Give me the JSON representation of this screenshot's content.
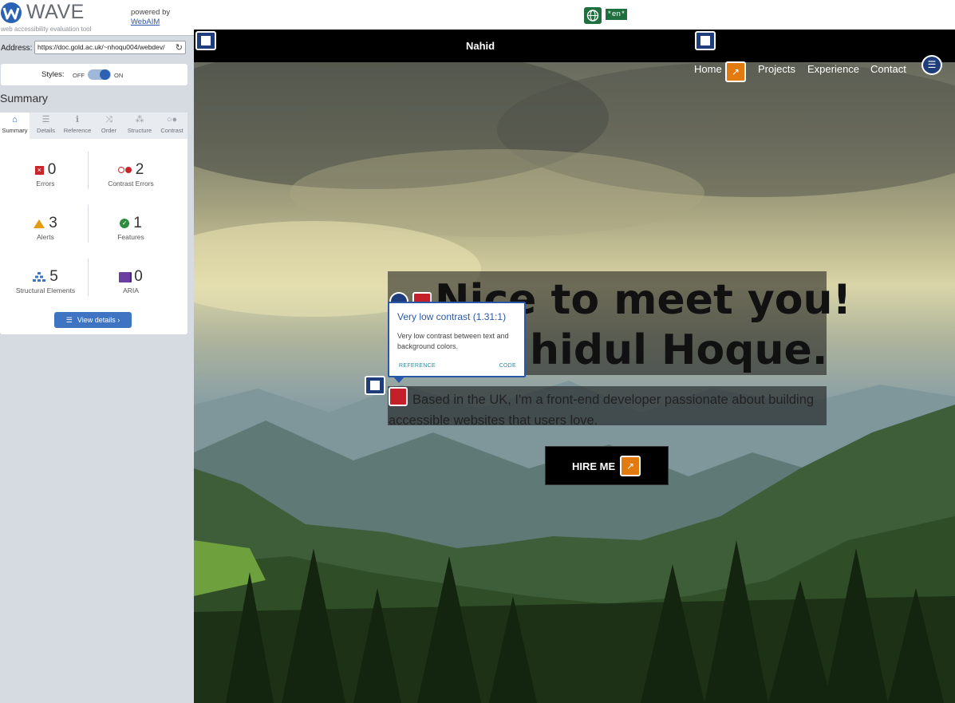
{
  "wave": {
    "logo_text": "WAVE",
    "tagline": "web accessibility evaluation tool",
    "powered_by": "powered by",
    "webaim": "WebAIM",
    "address_label": "Address:",
    "address_value": "https://doc.gold.ac.uk/~nhoqu004/webdev/",
    "styles_label": "Styles:",
    "styles_off": "OFF",
    "styles_on": "ON",
    "summary_title": "Summary",
    "tabs": [
      {
        "label": "Summary",
        "icon": "home-icon",
        "glyph": "⌂"
      },
      {
        "label": "Details",
        "icon": "list-icon",
        "glyph": "☰"
      },
      {
        "label": "Reference",
        "icon": "info-icon",
        "glyph": "ℹ"
      },
      {
        "label": "Order",
        "icon": "order-icon",
        "glyph": "⤨"
      },
      {
        "label": "Structure",
        "icon": "structure-icon",
        "glyph": "⁂"
      },
      {
        "label": "Contrast",
        "icon": "contrast-icon",
        "glyph": "○●"
      }
    ],
    "stats": {
      "errors": {
        "count": "0",
        "label": "Errors"
      },
      "contrast_errors": {
        "count": "2",
        "label": "Contrast Errors"
      },
      "alerts": {
        "count": "3",
        "label": "Alerts"
      },
      "features": {
        "count": "1",
        "label": "Features"
      },
      "structural": {
        "count": "5",
        "label": "Structural Elements"
      },
      "aria": {
        "count": "0",
        "label": "ARIA"
      }
    },
    "view_details": "View details ›"
  },
  "page": {
    "lang_badge": "*en*",
    "brand": "Nahid",
    "nav": [
      "Home",
      "Projects",
      "Experience",
      "Contact"
    ],
    "heading_line1": "Nice to meet you!",
    "heading_line2": "hidul Hoque.",
    "description": "Based in the UK, I'm a front-end developer passionate about building accessible websites that users love.",
    "hire_button": "HIRE ME"
  },
  "tooltip": {
    "title": "Very low contrast (1.31:1)",
    "body": "Very low contrast between text and background colors.",
    "reference": "REFERENCE",
    "code": "CODE"
  },
  "colors": {
    "wave_blue": "#2b62b5",
    "error_red": "#c8262b",
    "alert_orange": "#e17b10",
    "feature_green": "#2e8b3e",
    "aria_purple": "#6b3fa0"
  }
}
